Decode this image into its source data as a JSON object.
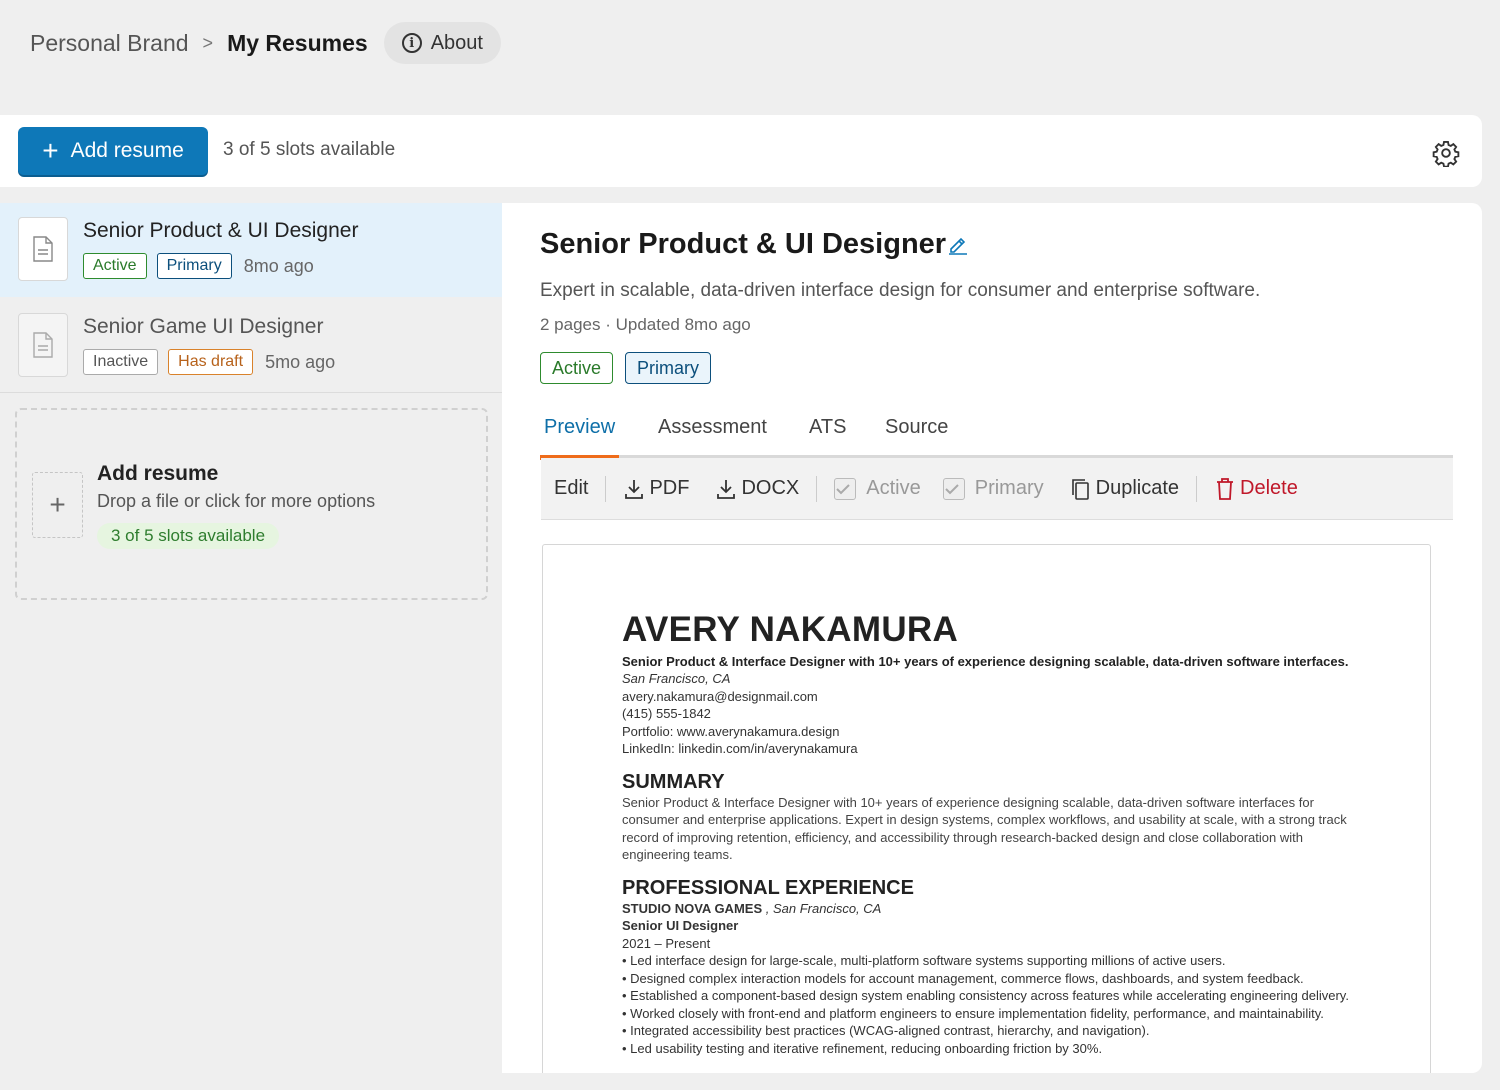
{
  "breadcrumb": {
    "root": "Personal Brand",
    "separator": ">",
    "current": "My Resumes",
    "about_label": "About"
  },
  "toolbar": {
    "add_label": "Add resume",
    "slots": "3 of 5 slots available"
  },
  "resumes": [
    {
      "title": "Senior Product & UI Designer",
      "badges": [
        "Active",
        "Primary"
      ],
      "age": "8mo ago",
      "selected": true
    },
    {
      "title": "Senior Game UI Designer",
      "badges": [
        "Inactive",
        "Has draft"
      ],
      "age": "5mo ago",
      "selected": false
    }
  ],
  "dropzone": {
    "title": "Add resume",
    "subtitle": "Drop a file or click for more options",
    "slots": "3 of 5 slots available"
  },
  "detail": {
    "title": "Senior Product & UI Designer",
    "description": "Expert in scalable, data-driven interface design for consumer and enterprise software.",
    "meta": "2 pages · Updated 8mo ago",
    "badges": [
      "Active",
      "Primary"
    ],
    "tabs": [
      "Preview",
      "Assessment",
      "ATS",
      "Source"
    ],
    "active_tab": "Preview",
    "actions": {
      "edit": "Edit",
      "pdf": "PDF",
      "docx": "DOCX",
      "active": "Active",
      "primary": "Primary",
      "duplicate": "Duplicate",
      "delete": "Delete"
    }
  },
  "cv": {
    "name": "AVERY NAKAMURA",
    "headline": "Senior Product & Interface Designer with 10+ years of experience designing scalable, data-driven software interfaces.",
    "location": "San Francisco, CA",
    "email": "avery.nakamura@designmail.com",
    "phone": "(415) 555-1842",
    "portfolio": "Portfolio: www.averynakamura.design",
    "linkedin": "LinkedIn: linkedin.com/in/averynakamura",
    "summary_heading": "SUMMARY",
    "summary_lines": [
      "Senior Product & Interface Designer with 10+ years of experience designing scalable, data-driven software interfaces for",
      "consumer and enterprise applications. Expert in design systems, complex workflows, and usability at scale, with a strong track",
      "record of improving retention, efficiency, and accessibility through research-backed design and close collaboration with",
      "engineering teams."
    ],
    "experience_heading": "PROFESSIONAL EXPERIENCE",
    "company": "STUDIO NOVA GAMES",
    "company_location": " , San Francisco, CA",
    "role": "Senior UI Designer",
    "dates": "2021 – Present",
    "bullets": [
      "• Led interface design for large-scale, multi-platform software systems supporting millions of active users.",
      "• Designed complex interaction models for account management, commerce flows, dashboards, and system feedback.",
      "• Established a component-based design system enabling consistency across features while accelerating engineering delivery.",
      "• Worked closely with front-end and platform engineers to ensure implementation fidelity, performance, and maintainability.",
      "• Integrated accessibility best practices (WCAG-aligned contrast, hierarchy, and navigation).",
      "• Led usability testing and iterative refinement, reducing onboarding friction by 30%."
    ]
  },
  "colors": {
    "accent": "#0e78b8",
    "tab_active": "#0e6fa8",
    "tab_underline": "#ef6c1a",
    "active_green": "#2e8b2e",
    "primary_navy": "#0c4f7c",
    "draft_orange": "#d9822b",
    "danger": "#c0182a",
    "selected_row": "#e3f1fb"
  }
}
